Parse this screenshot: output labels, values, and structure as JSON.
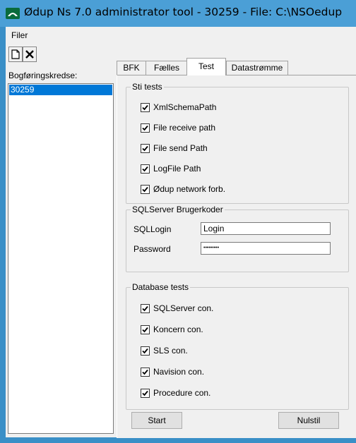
{
  "window": {
    "title": "Ødup Ns 7.0 administrator tool - 30259 - File: C:\\NSOedup",
    "accent": "#4b9fd6"
  },
  "menu": {
    "items": [
      "Filer"
    ]
  },
  "toolbar": {
    "buttons": [
      "new-document-icon",
      "delete-icon"
    ]
  },
  "sidebar": {
    "label": "Bogføringskredse:",
    "items": [
      {
        "label": "30259",
        "selected": true
      }
    ]
  },
  "tabs": [
    {
      "label": "BFK",
      "active": false
    },
    {
      "label": "Fælles",
      "active": false
    },
    {
      "label": "Test",
      "active": true
    },
    {
      "label": "Datastrømme",
      "active": false
    }
  ],
  "sti_tests": {
    "title": "Sti tests",
    "items": [
      {
        "label": "XmlSchemaPath",
        "checked": true
      },
      {
        "label": "File receive path",
        "checked": true
      },
      {
        "label": "File send Path",
        "checked": true
      },
      {
        "label": "LogFile Path",
        "checked": true
      },
      {
        "label": "Ødup network forb.",
        "checked": true
      }
    ]
  },
  "sql": {
    "title": "SQLServer Brugerkoder",
    "login_label": "SQLLogin",
    "login_value": "Login",
    "password_label": "Password",
    "password_value": "•••••••••"
  },
  "db_tests": {
    "title": "Database tests",
    "items": [
      {
        "label": "SQLServer con.",
        "checked": true
      },
      {
        "label": "Koncern con.",
        "checked": true
      },
      {
        "label": "SLS con.",
        "checked": true
      },
      {
        "label": "Navision con.",
        "checked": true
      },
      {
        "label": "Procedure con.",
        "checked": true
      }
    ]
  },
  "buttons": {
    "start": "Start",
    "reset": "Nulstil"
  }
}
